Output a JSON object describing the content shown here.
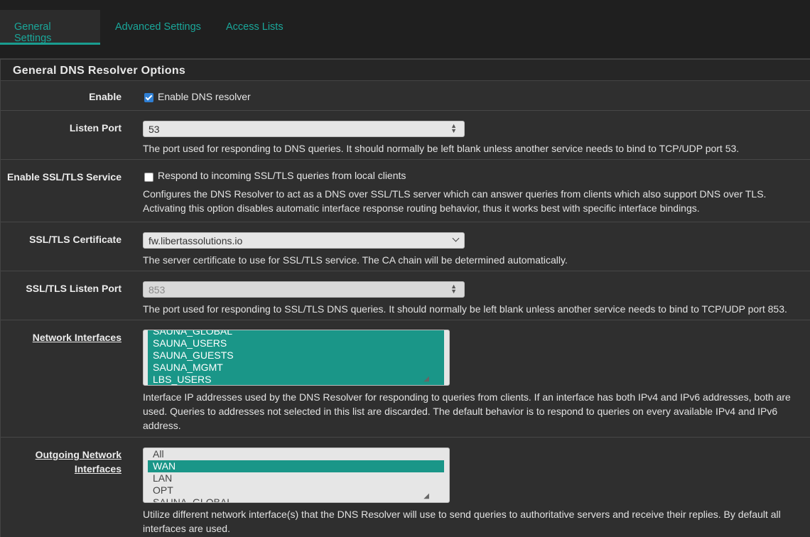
{
  "tabs": [
    {
      "label": "General Settings",
      "active": true
    },
    {
      "label": "Advanced Settings",
      "active": false
    },
    {
      "label": "Access Lists",
      "active": false
    }
  ],
  "panel": {
    "title": "General DNS Resolver Options"
  },
  "enable": {
    "label": "Enable",
    "checkbox_label": "Enable DNS resolver",
    "checked": true
  },
  "listen_port": {
    "label": "Listen Port",
    "value": "53",
    "help": "The port used for responding to DNS queries. It should normally be left blank unless another service needs to bind to TCP/UDP port 53."
  },
  "ssl_service": {
    "label": "Enable SSL/TLS Service",
    "checkbox_label": "Respond to incoming SSL/TLS queries from local clients",
    "checked": false,
    "help": "Configures the DNS Resolver to act as a DNS over SSL/TLS server which can answer queries from clients which also support DNS over TLS. Activating this option disables automatic interface response routing behavior, thus it works best with specific interface bindings."
  },
  "ssl_cert": {
    "label": "SSL/TLS Certificate",
    "value": "fw.libertassolutions.io",
    "help": "The server certificate to use for SSL/TLS service. The CA chain will be determined automatically."
  },
  "ssl_port": {
    "label": "SSL/TLS Listen Port",
    "placeholder": "853",
    "help": "The port used for responding to SSL/TLS DNS queries. It should normally be left blank unless another service needs to bind to TCP/UDP port 853."
  },
  "network_interfaces": {
    "label": "Network Interfaces",
    "options": [
      {
        "label": "SAUNA_GLOBAL",
        "selected": true
      },
      {
        "label": "SAUNA_USERS",
        "selected": true
      },
      {
        "label": "SAUNA_GUESTS",
        "selected": true
      },
      {
        "label": "SAUNA_MGMT",
        "selected": true
      },
      {
        "label": "LBS_USERS",
        "selected": true
      }
    ],
    "help": "Interface IP addresses used by the DNS Resolver for responding to queries from clients. If an interface has both IPv4 and IPv6 addresses, both are used. Queries to addresses not selected in this list are discarded. The default behavior is to respond to queries on every available IPv4 and IPv6 address."
  },
  "outgoing_interfaces": {
    "label_line1": "Outgoing Network",
    "label_line2": "Interfaces",
    "options": [
      {
        "label": "All",
        "selected": false
      },
      {
        "label": "WAN",
        "selected": true
      },
      {
        "label": "LAN",
        "selected": false
      },
      {
        "label": "OPT",
        "selected": false
      },
      {
        "label": "SAUNA_GLOBAL",
        "selected": false
      }
    ],
    "help": "Utilize different network interface(s) that the DNS Resolver will use to send queries to authoritative servers and receive their replies. By default all interfaces are used."
  },
  "colors": {
    "accent": "#1aa79a",
    "selected_option": "#1a9688",
    "checkbox": "#2f7fd4"
  }
}
